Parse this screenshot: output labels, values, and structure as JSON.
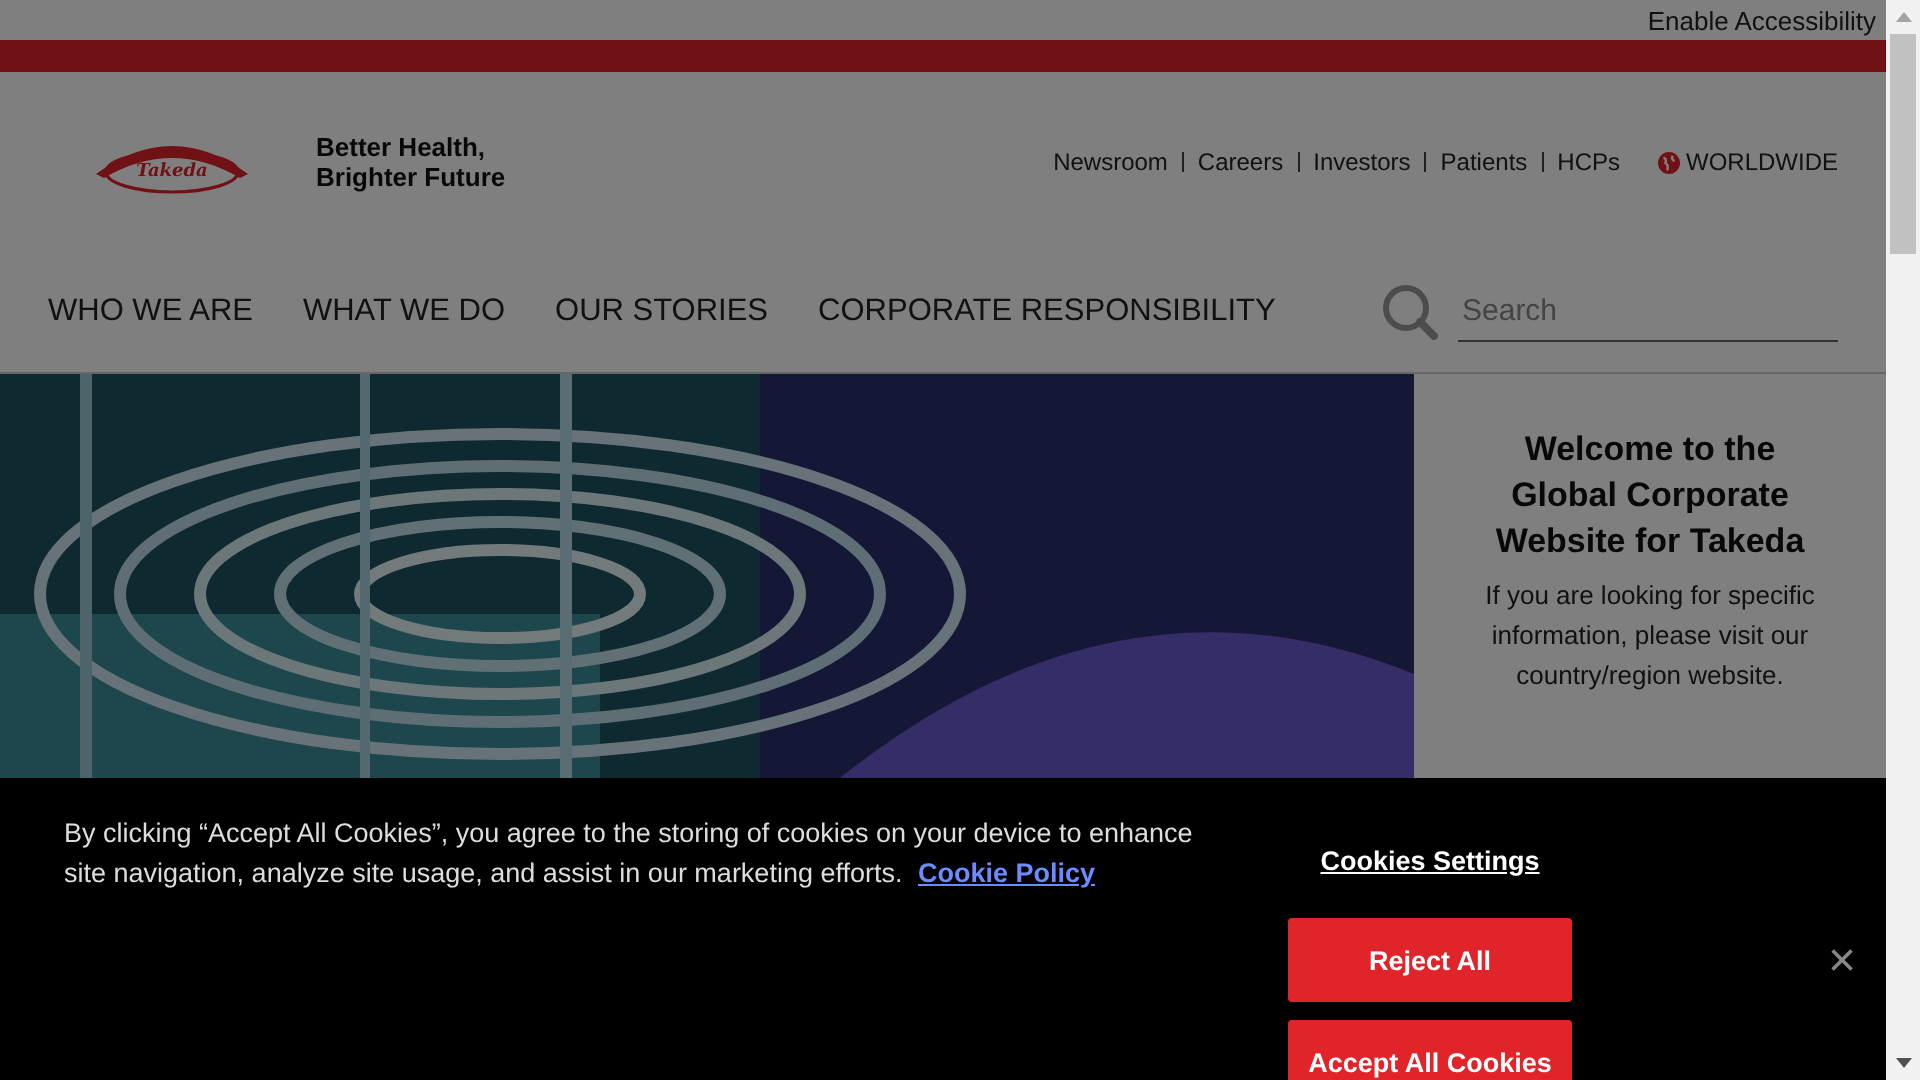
{
  "accessibility_link": "Enable Accessibility",
  "header": {
    "logo_text": "Takeda",
    "tagline": "Better Health, Brighter Future",
    "top_links": [
      "Newsroom",
      "Careers",
      "Investors",
      "Patients",
      "HCPs"
    ],
    "region_link": "WORLDWIDE"
  },
  "nav": [
    "WHO WE ARE",
    "WHAT WE DO",
    "OUR STORIES",
    "CORPORATE RESPONSIBILITY"
  ],
  "search": {
    "placeholder": "Search"
  },
  "hero": {
    "kind": "picture"
  },
  "welcome": {
    "title": "Welcome to the Global Corporate Website for Takeda",
    "body": "If you are looking for specific information, please visit our country/region website."
  },
  "cookie_banner": {
    "text": "By clicking “Accept All Cookies”, you agree to the storing of cookies on your device to enhance site navigation, analyze site usage, and assist in our marketing efforts.",
    "policy_link": "Cookie Policy",
    "settings": "Cookies Settings",
    "reject": "Reject All",
    "accept": "Accept All Cookies",
    "close": "×"
  }
}
